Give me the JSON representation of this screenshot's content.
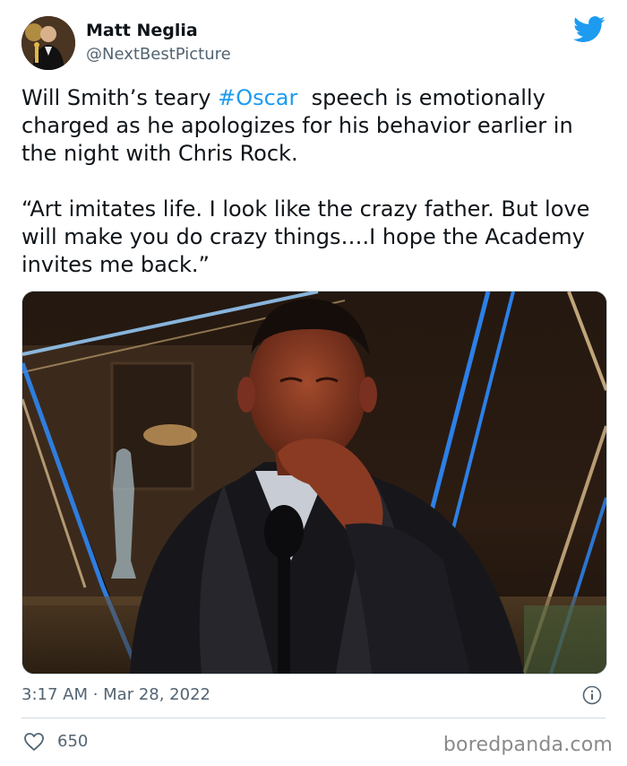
{
  "author": {
    "name": "Matt Neglia",
    "handle": "@NextBestPicture"
  },
  "tweet": {
    "before_hashtag": "Will Smith’s teary ",
    "hashtag": "#Oscar",
    "after_hashtag": "  speech is emotionally charged as he apologizes for his behavior earlier in the night with Chris Rock.\n\n“Art imitates life. I look like the crazy father. But love will make you do crazy things….I hope the Academy invites me back.”"
  },
  "meta": {
    "timestamp": "3:17 AM · Mar 28, 2022",
    "likes": "650"
  },
  "watermark": "boredpanda.com",
  "colors": {
    "accent": "#1d9bf0",
    "text": "#0f1419",
    "secondary": "#536471"
  },
  "icons": [
    "twitter-bird-icon",
    "info-icon",
    "heart-icon"
  ]
}
